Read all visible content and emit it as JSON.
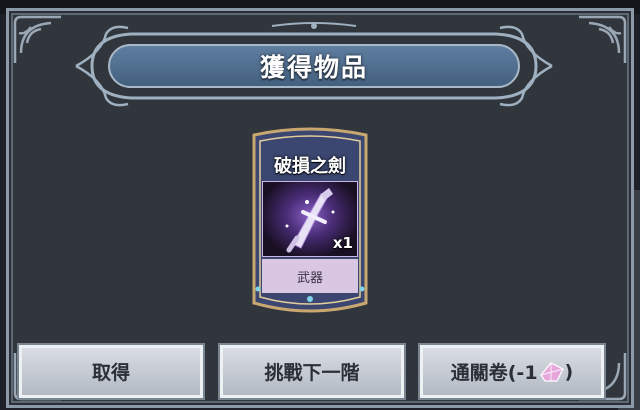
{
  "dialog": {
    "title": "獲得物品"
  },
  "item": {
    "name": "破損之劍",
    "quantity": "x1",
    "type": "武器",
    "image_icon": "broken-sword-icon"
  },
  "buttons": {
    "take": "取得",
    "challenge_next": "挑戰下一階",
    "clear_ticket_prefix": "通關卷(-1",
    "clear_ticket_suffix": ")",
    "clear_ticket_icon": "crystal-gem-icon"
  },
  "colors": {
    "panel_bg": "#31353c",
    "title_bar": "#4f6e90",
    "card_type_bg": "#d9c6e3",
    "button_bg": "#c8cdd4"
  }
}
